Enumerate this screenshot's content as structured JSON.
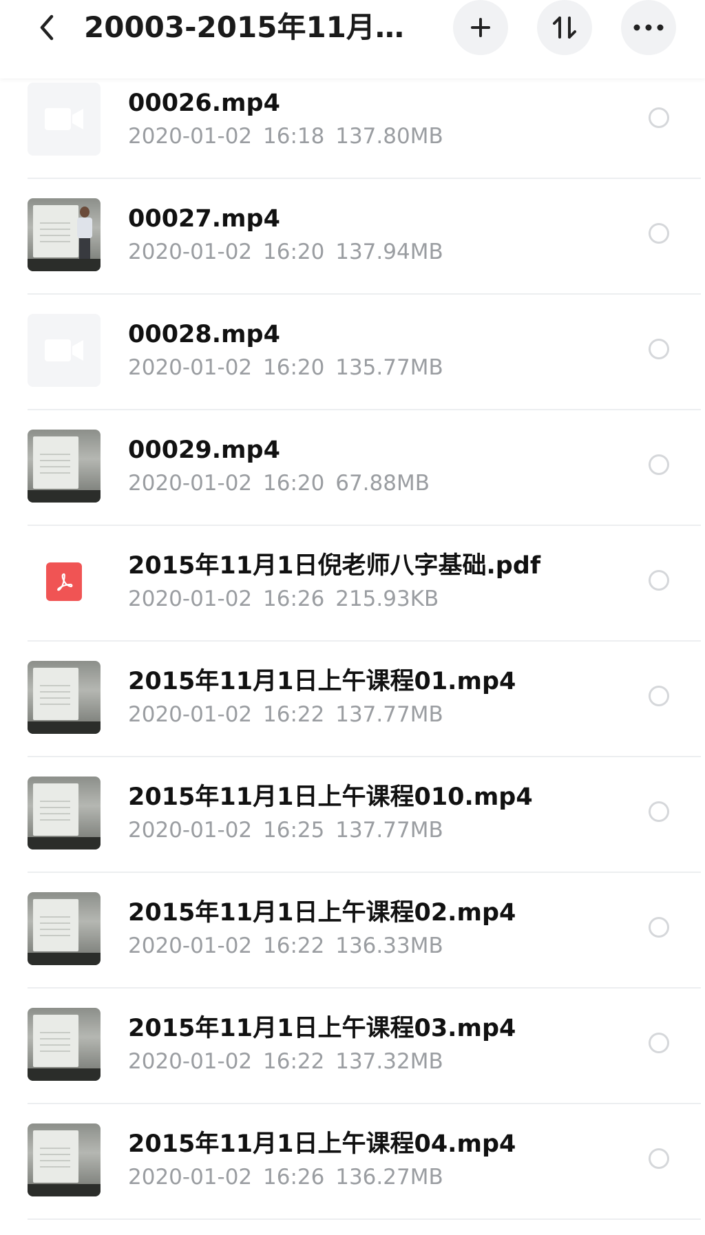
{
  "header": {
    "title": "20003-2015年11月1...",
    "back_icon": "chevron-left-icon",
    "add_icon": "plus-icon",
    "sort_icon": "sort-icon",
    "more_icon": "more-dots-icon"
  },
  "files": [
    {
      "name": "00026.mp4",
      "date": "2020-01-02",
      "time": "16:18",
      "size": "137.80MB",
      "thumb": "video-placeholder"
    },
    {
      "name": "00027.mp4",
      "date": "2020-01-02",
      "time": "16:20",
      "size": "137.94MB",
      "thumb": "video-frame-person"
    },
    {
      "name": "00028.mp4",
      "date": "2020-01-02",
      "time": "16:20",
      "size": "135.77MB",
      "thumb": "video-placeholder"
    },
    {
      "name": "00029.mp4",
      "date": "2020-01-02",
      "time": "16:20",
      "size": "67.88MB",
      "thumb": "video-frame"
    },
    {
      "name": "2015年11月1日倪老师八字基础.pdf",
      "date": "2020-01-02",
      "time": "16:26",
      "size": "215.93KB",
      "thumb": "pdf"
    },
    {
      "name": "2015年11月1日上午课程01.mp4",
      "date": "2020-01-02",
      "time": "16:22",
      "size": "137.77MB",
      "thumb": "video-frame"
    },
    {
      "name": "2015年11月1日上午课程010.mp4",
      "date": "2020-01-02",
      "time": "16:25",
      "size": "137.77MB",
      "thumb": "video-frame"
    },
    {
      "name": "2015年11月1日上午课程02.mp4",
      "date": "2020-01-02",
      "time": "16:22",
      "size": "136.33MB",
      "thumb": "video-frame"
    },
    {
      "name": "2015年11月1日上午课程03.mp4",
      "date": "2020-01-02",
      "time": "16:22",
      "size": "137.32MB",
      "thumb": "video-frame"
    },
    {
      "name": "2015年11月1日上午课程04.mp4",
      "date": "2020-01-02",
      "time": "16:26",
      "size": "136.27MB",
      "thumb": "video-frame"
    }
  ],
  "colors": {
    "pdf_red": "#f05454",
    "meta_gray": "#9a9da1",
    "button_bg": "#f1f2f4"
  }
}
